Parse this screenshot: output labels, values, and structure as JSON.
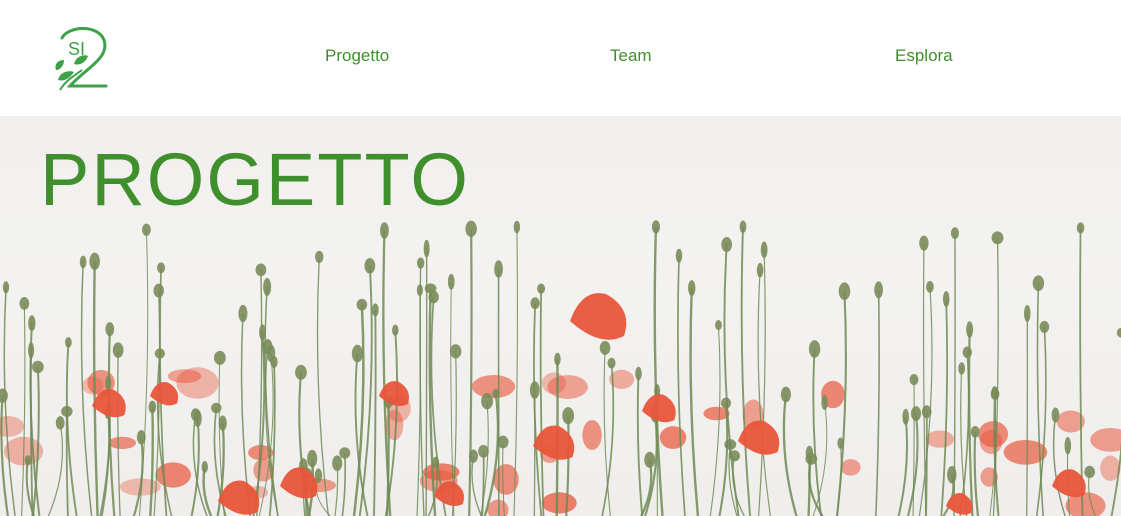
{
  "header": {
    "logo": {
      "text": "SI",
      "icon": "leaf-logo-icon"
    },
    "nav": [
      {
        "label": "Progetto"
      },
      {
        "label": "Team"
      },
      {
        "label": "Esplora"
      }
    ]
  },
  "hero": {
    "title": "PROGETTO",
    "image": "poppy-field-photo"
  },
  "colors": {
    "accent": "#3f8f2c",
    "poppy": "#e8553a",
    "stem": "#6f8a55"
  }
}
